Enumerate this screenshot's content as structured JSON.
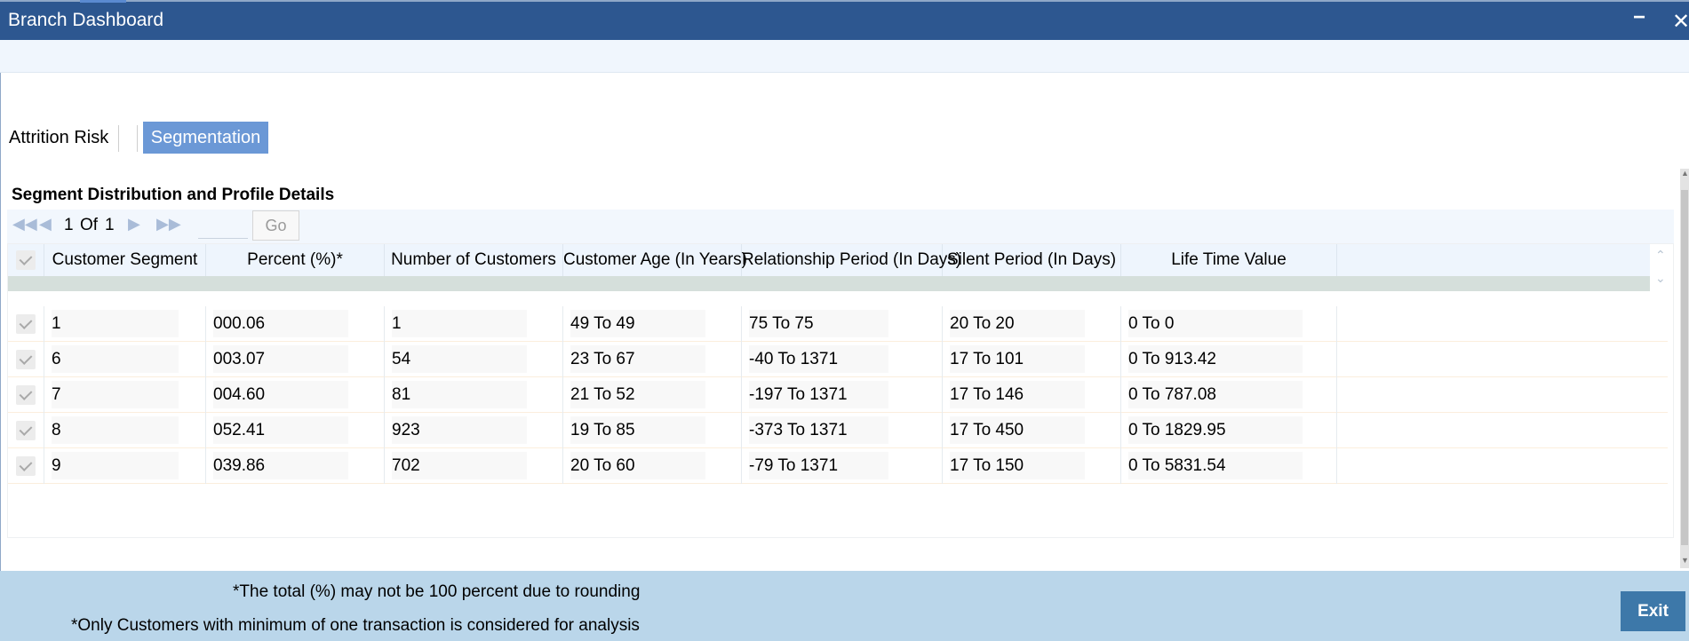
{
  "window": {
    "title": "Branch Dashboard",
    "minimize": "−",
    "close": "✕"
  },
  "tabs": [
    {
      "label": "Attrition Risk",
      "active": false
    },
    {
      "label": "Segmentation",
      "active": true
    }
  ],
  "section": {
    "title": "Segment Distribution and Profile Details"
  },
  "pager": {
    "current": "1",
    "of": "Of",
    "total": "1",
    "go_label": "Go",
    "input_value": ""
  },
  "table": {
    "columns": [
      "Customer Segment",
      "Percent (%)*",
      "Number of Customers",
      "Customer Age (In Years)",
      "Relationship Period (In Days)",
      "Silent Period (In Days)",
      "Life Time Value"
    ],
    "rows": [
      [
        "1",
        "000.06",
        "1",
        "49 To 49",
        "75 To 75",
        "20 To 20",
        "0 To 0"
      ],
      [
        "6",
        "003.07",
        "54",
        "23 To 67",
        "-40 To 1371",
        "17 To 101",
        "0 To 913.42"
      ],
      [
        "7",
        "004.60",
        "81",
        "21 To 52",
        "-197 To 1371",
        "17 To 146",
        "0 To 787.08"
      ],
      [
        "8",
        "052.41",
        "923",
        "19 To 85",
        "-373 To 1371",
        "17 To 450",
        "0 To 1829.95"
      ],
      [
        "9",
        "039.86",
        "702",
        "20 To 60",
        "-79 To 1371",
        "17 To 150",
        "0 To 5831.54"
      ]
    ]
  },
  "footer": {
    "note1": "*The total (%) may not be 100 percent due to rounding",
    "note2": "*Only Customers with minimum of one transaction is considered for analysis",
    "exit_label": "Exit"
  },
  "colors": {
    "titlebar": "#2d5790",
    "active_tab": "#6b98d6",
    "footer": "#bad6ea",
    "exit_button": "#3d78a9"
  }
}
